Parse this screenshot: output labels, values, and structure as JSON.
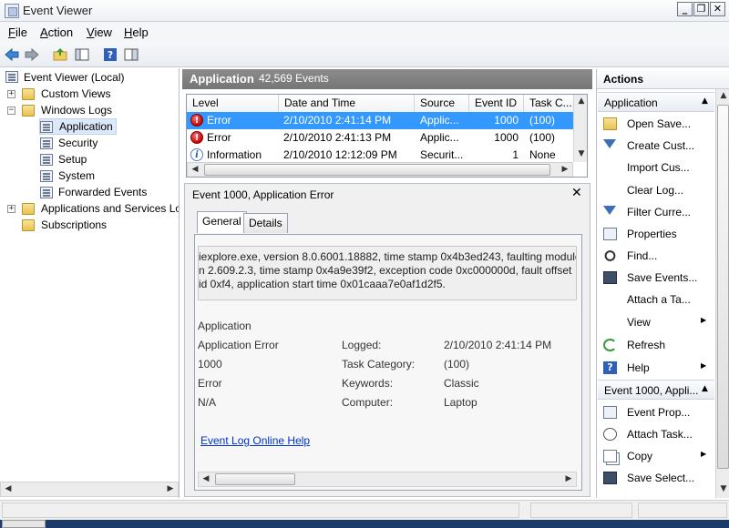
{
  "window": {
    "title": "Event Viewer"
  },
  "menu": [
    {
      "label": "File",
      "ul": "F",
      "rest": "ile"
    },
    {
      "label": "Action",
      "ul": "A",
      "rest": "ction"
    },
    {
      "label": "View",
      "ul": "V",
      "rest": "iew"
    },
    {
      "label": "Help",
      "ul": "H",
      "rest": "elp"
    }
  ],
  "tree": {
    "root": "Event Viewer (Local)",
    "custom_views": "Custom Views",
    "windows_logs": "Windows Logs",
    "application": "Application",
    "security": "Security",
    "setup": "Setup",
    "system": "System",
    "forwarded": "Forwarded Events",
    "apps_services": "Applications and Services Lo",
    "subscriptions": "Subscriptions"
  },
  "center": {
    "log_name": "Application",
    "event_count": "42,569 Events",
    "columns": [
      "Level",
      "Date and Time",
      "Source",
      "Event ID",
      "Task C..."
    ],
    "rows": [
      {
        "level": "Error",
        "datetime": "2/10/2010 2:41:14 PM",
        "source": "Applic...",
        "event_id": "1000",
        "task": "(100)",
        "status": "error",
        "selected": true
      },
      {
        "level": "Error",
        "datetime": "2/10/2010 2:41:13 PM",
        "source": "Applic...",
        "event_id": "1000",
        "task": "(100)",
        "status": "error",
        "selected": false
      },
      {
        "level": "Information",
        "datetime": "2/10/2010 12:12:09 PM",
        "source": "Securit...",
        "event_id": "1",
        "task": "None",
        "status": "info",
        "selected": false
      }
    ]
  },
  "detail": {
    "title": "Event 1000, Application Error",
    "tabs": {
      "general": "General",
      "details": "Details"
    },
    "description": [
      "iexplore.exe, version 8.0.6001.18882, time stamp 0x4b3ed243, faulting module",
      "n 2.609.2.3, time stamp 0x4a9e39f2, exception code 0xc000000d, fault offset",
      "id 0xf4, application start time 0x01caaa7e0af1d2f5."
    ],
    "fields": {
      "log_name": "Application",
      "source": "Application Error",
      "event_id": "1000",
      "level": "Error",
      "user": "N/A",
      "logged_label": "Logged:",
      "logged_value": "2/10/2010 2:41:14 PM",
      "task_label": "Task Category:",
      "task_value": "(100)",
      "keywords_label": "Keywords:",
      "keywords_value": "Classic",
      "computer_label": "Computer:",
      "computer_value": "Laptop"
    },
    "link": "Event Log Online Help"
  },
  "actions": {
    "title": "Actions",
    "group1": "Application",
    "items1": [
      {
        "label": "Open Save...",
        "icon": "folder-open-icon"
      },
      {
        "label": "Create Cust...",
        "icon": "filter-icon"
      },
      {
        "label": "Import Cus...",
        "icon": "blank-icon"
      },
      {
        "label": "Clear Log...",
        "icon": "blank-icon"
      },
      {
        "label": "Filter Curre...",
        "icon": "filter-icon"
      },
      {
        "label": "Properties",
        "icon": "properties-icon"
      },
      {
        "label": "Find...",
        "icon": "find-icon"
      },
      {
        "label": "Save Events...",
        "icon": "disk-icon"
      },
      {
        "label": "Attach a Ta...",
        "icon": "blank-icon"
      },
      {
        "label": "View",
        "icon": "blank-icon",
        "submenu": true
      },
      {
        "label": "Refresh",
        "icon": "refresh-icon"
      },
      {
        "label": "Help",
        "icon": "help-icon",
        "submenu": true
      }
    ],
    "group2": "Event 1000, Appli...",
    "items2": [
      {
        "label": "Event Prop...",
        "icon": "properties-icon"
      },
      {
        "label": "Attach Task...",
        "icon": "task-icon"
      },
      {
        "label": "Copy",
        "icon": "copy-icon",
        "submenu": true
      },
      {
        "label": "Save Select...",
        "icon": "disk-icon"
      }
    ]
  }
}
